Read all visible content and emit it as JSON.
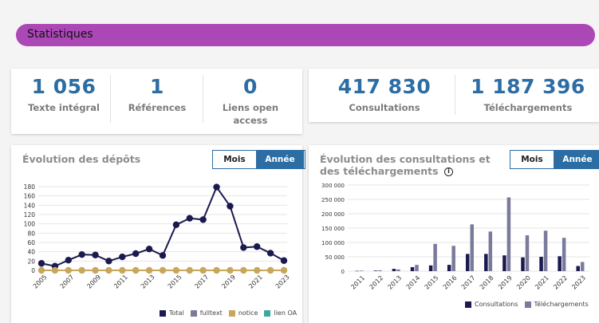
{
  "banner": {
    "title": "Statistiques"
  },
  "stats_left": [
    {
      "value": "1 056",
      "label": "Texte intégral"
    },
    {
      "value": "1",
      "label": "Références"
    },
    {
      "value": "0",
      "label": "Liens open access"
    }
  ],
  "stats_right": [
    {
      "value": "417 830",
      "label": "Consultations"
    },
    {
      "value": "1 187 396",
      "label": "Téléchargements"
    }
  ],
  "deposits": {
    "title": "Évolution des dépôts",
    "toggle": {
      "month": "Mois",
      "year": "Année",
      "selected": "Année"
    }
  },
  "consult": {
    "title": "Évolution des consultations et des téléchargements",
    "info_icon": "info-circle-icon",
    "toggle": {
      "month": "Mois",
      "year": "Année",
      "selected": "Année"
    }
  },
  "chart_data": [
    {
      "type": "line",
      "x": [
        "2005",
        "2006",
        "2007",
        "2008",
        "2009",
        "2010",
        "2011",
        "2012",
        "2013",
        "2014",
        "2015",
        "2016",
        "2017",
        "2018",
        "2019",
        "2020",
        "2021",
        "2022",
        "2023"
      ],
      "x_ticks": [
        "2005",
        "2007",
        "2009",
        "2011",
        "2013",
        "2015",
        "2017",
        "2019",
        "2021",
        "2023"
      ],
      "ylim": [
        0,
        180
      ],
      "y_ticks": [
        0,
        20,
        40,
        60,
        80,
        100,
        120,
        140,
        160,
        180
      ],
      "grid": true,
      "legend": "bottom-right",
      "series": [
        {
          "name": "Total",
          "color": "#1b1a4f",
          "values": [
            15,
            9,
            22,
            34,
            33,
            20,
            29,
            36,
            46,
            32,
            98,
            112,
            109,
            179,
            138,
            49,
            51,
            37,
            21
          ]
        },
        {
          "name": "fulltext",
          "color": "#7a7a9c",
          "values": [
            0,
            0,
            0,
            0,
            0,
            0,
            0,
            0,
            0,
            0,
            0,
            0,
            0,
            0,
            0,
            0,
            0,
            0,
            0
          ]
        },
        {
          "name": "notice",
          "color": "#c8a75c",
          "values": [
            0,
            0,
            0,
            0,
            0,
            0,
            0,
            0,
            0,
            0,
            0,
            0,
            0,
            0,
            0,
            0,
            0,
            0,
            0
          ]
        },
        {
          "name": "lien OA",
          "color": "#3ba8a0",
          "values": []
        }
      ]
    },
    {
      "type": "bar",
      "categories": [
        "2011",
        "2012",
        "2013",
        "2014",
        "2015",
        "2016",
        "2017",
        "2018",
        "2019",
        "2020",
        "2021",
        "2022",
        "2023"
      ],
      "ylim": [
        0,
        300000
      ],
      "y_ticks": [
        "0",
        "50 000",
        "100 000",
        "150 000",
        "200 000",
        "250 000",
        "300 000"
      ],
      "grid": true,
      "legend": "bottom-right",
      "series": [
        {
          "name": "Consultations",
          "color": "#1b1a4f",
          "values": [
            1000,
            2000,
            8000,
            14000,
            20000,
            22000,
            60000,
            60000,
            55000,
            48000,
            50000,
            52000,
            18000
          ]
        },
        {
          "name": "Téléchargements",
          "color": "#7a7a9c",
          "values": [
            2000,
            3000,
            6000,
            22000,
            95000,
            88000,
            163000,
            138000,
            257000,
            125000,
            141000,
            116000,
            32000
          ]
        }
      ]
    }
  ]
}
